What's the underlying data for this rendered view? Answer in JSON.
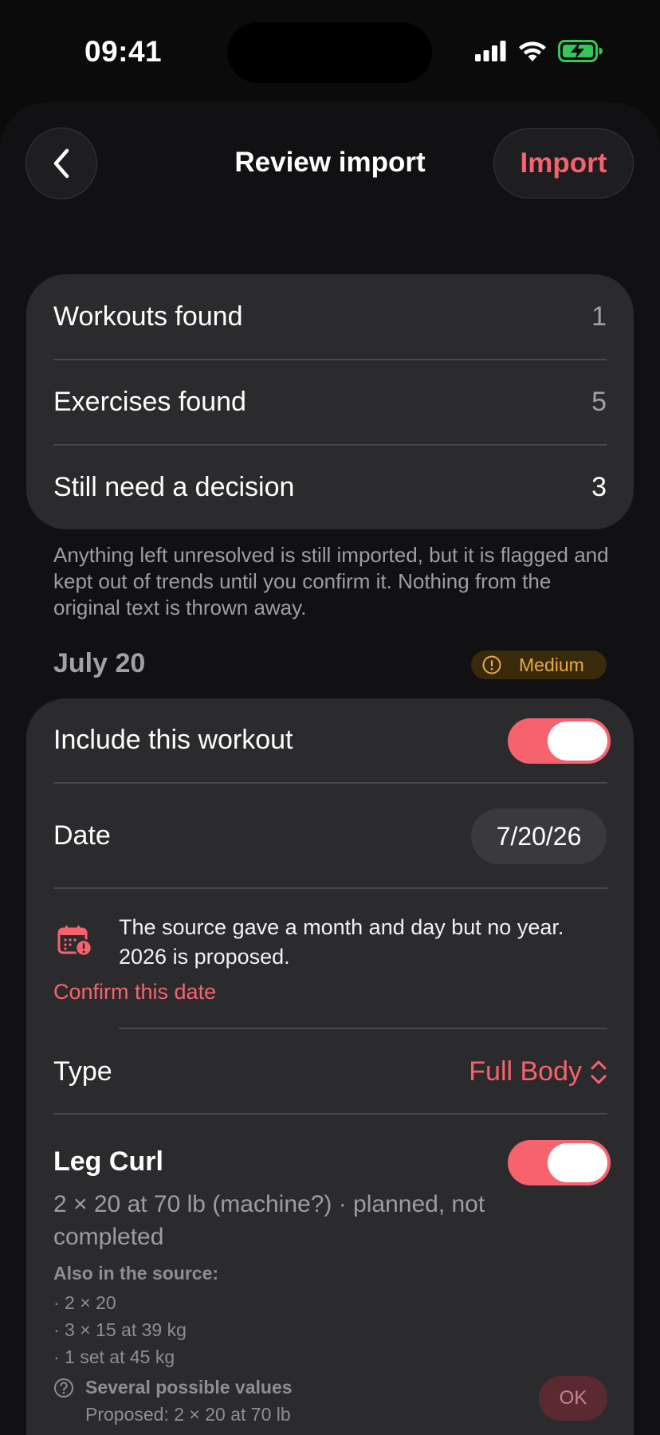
{
  "status_bar": {
    "time": "09:41"
  },
  "nav": {
    "title": "Review import",
    "action_label": "Import"
  },
  "summary": {
    "rows": [
      {
        "label": "Workouts found",
        "value": "1"
      },
      {
        "label": "Exercises found",
        "value": "5"
      },
      {
        "label": "Still need a decision",
        "value": "3"
      }
    ],
    "footnote": "Anything left unresolved is still imported, but it is flagged and kept out of trends until you confirm it. Nothing from the original text is thrown away."
  },
  "workout": {
    "section_title": "July 20",
    "confidence_badge": "Medium",
    "include_label": "Include this workout",
    "include_on": true,
    "date_label": "Date",
    "date_value": "7/20/26",
    "date_warning": "The source gave a month and day but no year. 2026 is proposed.",
    "confirm_date_link": "Confirm this date",
    "type_label": "Type",
    "type_value": "Full Body",
    "exercise": {
      "name": "Leg Curl",
      "include_on": true,
      "summary": "2 × 20 at 70 lb (machine?) · planned, not completed",
      "also_title": "Also in the source:",
      "alternatives": [
        "· 2 × 20",
        "· 3 × 15 at 39 kg",
        "· 1 set at 45 kg"
      ],
      "question_title": "Several possible values",
      "proposed": "Proposed: 2 × 20 at 70 lb",
      "ok_label": "OK"
    }
  },
  "colors": {
    "accent": "#f7636d",
    "badge_text": "#ecaa3f",
    "badge_bg": "#3a2a0c",
    "card_bg": "#2b2b2e",
    "screen_bg": "#0b0b0c",
    "battery_green": "#34c759"
  },
  "icons": {
    "back": "chevron-left-icon",
    "badge": "exclamation-circle-icon",
    "date_warning": "calendar-alert-icon",
    "type": "chevron-up-down-icon",
    "question": "question-circle-icon"
  }
}
